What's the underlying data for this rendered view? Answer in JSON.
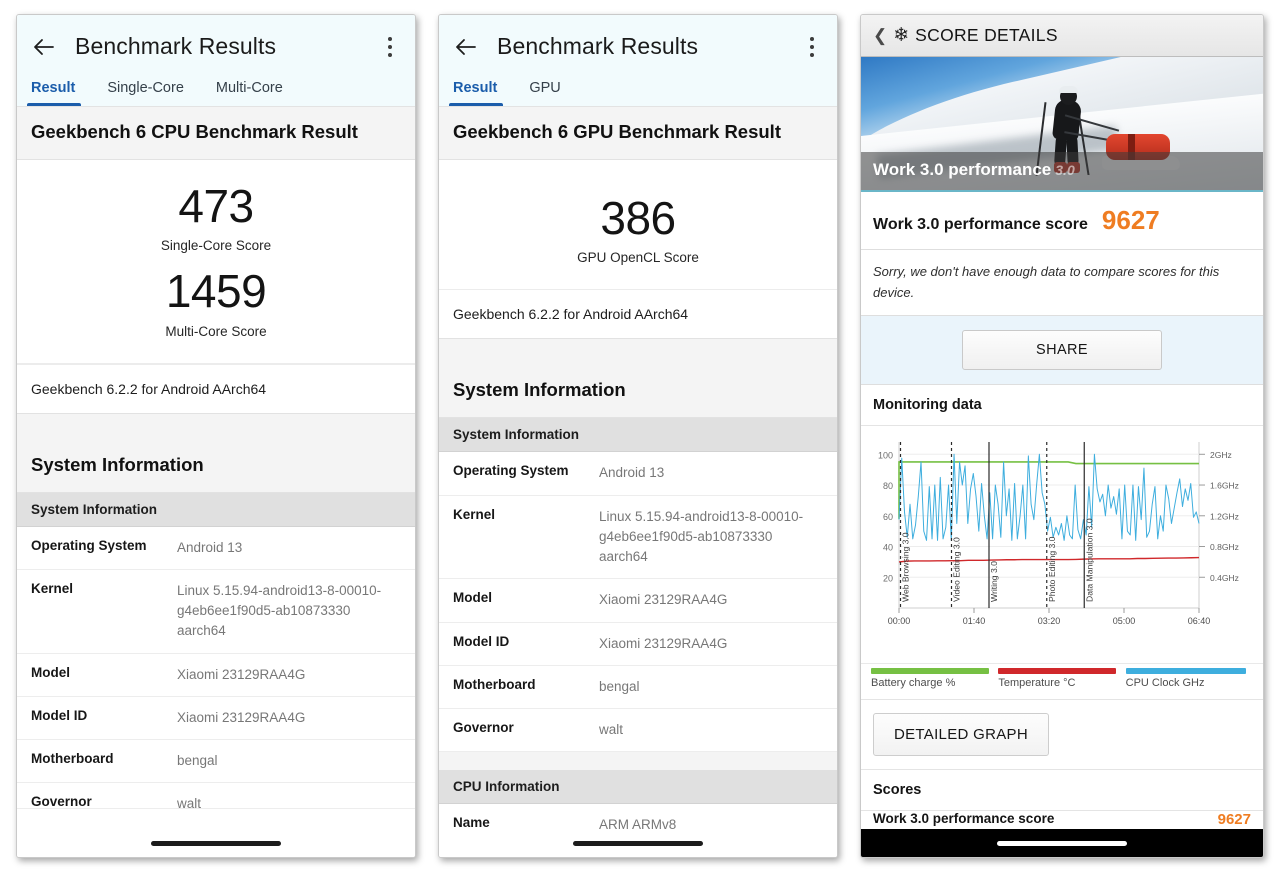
{
  "geekbench_cpu": {
    "appbar": {
      "back_icon": "back-arrow-icon",
      "title": "Benchmark Results",
      "menu_icon": "overflow-menu-icon"
    },
    "tabs": [
      {
        "label": "Result",
        "active": true
      },
      {
        "label": "Single-Core",
        "active": false
      },
      {
        "label": "Multi-Core",
        "active": false
      }
    ],
    "section_title": "Geekbench 6 CPU Benchmark Result",
    "scores": [
      {
        "value": "473",
        "label": "Single-Core Score"
      },
      {
        "value": "1459",
        "label": "Multi-Core Score"
      }
    ],
    "version": "Geekbench 6.2.2 for Android AArch64",
    "system_information_heading": "System Information",
    "system_information_subheader": "System Information",
    "rows": [
      {
        "key": "Operating System",
        "value": "Android 13"
      },
      {
        "key": "Kernel",
        "value": "Linux 5.15.94-android13-8-00010-g4eb6ee1f90d5-ab10873330 aarch64"
      },
      {
        "key": "Model",
        "value": "Xiaomi 23129RAA4G"
      },
      {
        "key": "Model ID",
        "value": "Xiaomi 23129RAA4G"
      },
      {
        "key": "Motherboard",
        "value": "bengal"
      },
      {
        "key": "Governor",
        "value": "walt"
      }
    ]
  },
  "geekbench_gpu": {
    "appbar": {
      "back_icon": "back-arrow-icon",
      "title": "Benchmark Results",
      "menu_icon": "overflow-menu-icon"
    },
    "tabs": [
      {
        "label": "Result",
        "active": true
      },
      {
        "label": "GPU",
        "active": false
      }
    ],
    "section_title": "Geekbench 6 GPU Benchmark Result",
    "scores": [
      {
        "value": "386",
        "label": "GPU OpenCL Score"
      }
    ],
    "version": "Geekbench 6.2.2 for Android AArch64",
    "system_information_heading": "System Information",
    "system_information_subheader": "System Information",
    "rows": [
      {
        "key": "Operating System",
        "value": "Android 13"
      },
      {
        "key": "Kernel",
        "value": "Linux 5.15.94-android13-8-00010-g4eb6ee1f90d5-ab10873330 aarch64"
      },
      {
        "key": "Model",
        "value": "Xiaomi 23129RAA4G"
      },
      {
        "key": "Model ID",
        "value": "Xiaomi 23129RAA4G"
      },
      {
        "key": "Motherboard",
        "value": "bengal"
      },
      {
        "key": "Governor",
        "value": "walt"
      }
    ],
    "cpu_information_subheader": "CPU Information",
    "cpu_rows": [
      {
        "key": "Name",
        "value": "ARM ARMv8"
      }
    ]
  },
  "pcmark": {
    "appbar": {
      "back_icon": "back-chevron-icon",
      "brand_icon": "snowflake-icon",
      "title": "SCORE DETAILS"
    },
    "hero_caption": "Work 3.0 performance",
    "hero_caption_faint": "3.0",
    "score_label": "Work 3.0 performance score",
    "score_value": "9627",
    "note": "Sorry, we don't have enough data to compare scores for this device.",
    "share_label": "SHARE",
    "monitoring_heading": "Monitoring data",
    "detailed_graph_label": "DETAILED GRAPH",
    "scores_heading": "Scores",
    "cut_row": {
      "label": "Work 3.0 performance score",
      "value": "9627"
    },
    "colors": {
      "battery": "#76c043",
      "temperature": "#d0282b",
      "cpu": "#3eaede",
      "score_accent": "#ef7d22"
    }
  },
  "chart_data": {
    "type": "line",
    "title": "Monitoring data",
    "xlabel": "",
    "ylabel": "",
    "grid": true,
    "legend_position": "bottom",
    "x_ticks": [
      "00:00",
      "01:40",
      "03:20",
      "05:00",
      "06:40"
    ],
    "xlim": [
      0,
      420
    ],
    "y_left_ticks": [
      20,
      40,
      60,
      80,
      100
    ],
    "ylim_left": [
      0,
      108
    ],
    "y_right_ticks": [
      "0.4GHz",
      "0.8GHz",
      "1.2GHz",
      "1.6GHz",
      "2GHz"
    ],
    "ylim_right": [
      0,
      2.16
    ],
    "annotations": [
      {
        "label": "Web Browsing 3.0",
        "x": "00:02"
      },
      {
        "label": "Video Editing 3.0",
        "x": "01:10"
      },
      {
        "label": "Writing 3.0",
        "x": "02:00"
      },
      {
        "label": "Photo Editing 3.0",
        "x": "03:17"
      },
      {
        "label": "Data Manipulation 3.0",
        "x": "04:07"
      }
    ],
    "series": [
      {
        "name": "Battery charge %",
        "color": "#76c043",
        "unit": "%",
        "axis": "left",
        "values": [
          95,
          95,
          95,
          95,
          95,
          95,
          95,
          95,
          95,
          95,
          95,
          95,
          95,
          95,
          95,
          95,
          95,
          95,
          95,
          95,
          95,
          95,
          95,
          94,
          94,
          94,
          94,
          94,
          94,
          94,
          94,
          94,
          94,
          94,
          94,
          94,
          94,
          94,
          94,
          94
        ]
      },
      {
        "name": "Temperature °C",
        "color": "#d0282b",
        "unit": "°C",
        "axis": "left",
        "values": [
          30,
          30.5,
          30.6,
          30.6,
          30.6,
          30.7,
          30.7,
          30.8,
          30.8,
          31,
          31,
          31,
          31.2,
          31.3,
          31.4,
          31.4,
          31.5,
          31.5,
          31.5,
          31.5,
          31.5,
          31.5,
          31.5,
          31.6,
          31.8,
          31.9,
          32,
          32,
          32,
          32,
          32,
          32.2,
          32.2,
          32.3,
          32.4,
          32.5,
          32.5,
          32.6,
          32.7,
          32.8
        ]
      },
      {
        "name": "CPU Clock GHz",
        "color": "#3eaede",
        "unit": "GHz",
        "axis": "right",
        "values": [
          1.15,
          1.95,
          1.25,
          0.92,
          1.35,
          0.9,
          1.08,
          1.45,
          1.9,
          1.0,
          0.88,
          1.58,
          0.9,
          1.6,
          0.88,
          1.7,
          0.9,
          1.05,
          1.6,
          0.88,
          2.0,
          1.1,
          1.9,
          1.6,
          1.85,
          1.1,
          1.55,
          1.75,
          1.45,
          1.0,
          1.62,
          1.2,
          0.9,
          1.5,
          0.9,
          1.6,
          1.35,
          0.92,
          1.9,
          1.2,
          1.55,
          0.88,
          1.62,
          0.9,
          1.2,
          1.6,
          0.9,
          1.98,
          1.35,
          1.15,
          1.6,
          2.0,
          1.5,
          1.35,
          1.0,
          1.18,
          0.92,
          1.05,
          0.95,
          1.1,
          0.88,
          1.2,
          0.95,
          0.9,
          1.6,
          1.02,
          0.9,
          1.15,
          0.95,
          1.58,
          1.05,
          2.0,
          1.55,
          1.38,
          1.48,
          1.2,
          1.6,
          1.3,
          1.45,
          1.22,
          1.55,
          0.9,
          1.6,
          1.0,
          0.95,
          1.6,
          0.88,
          1.58,
          1.15,
          1.82,
          0.92,
          1.0,
          1.35,
          1.58,
          0.9,
          1.2,
          1.0,
          1.6,
          1.42,
          1.1,
          1.3,
          1.5,
          1.68,
          1.32,
          1.55,
          1.4,
          1.62,
          1.18,
          1.25,
          1.1
        ]
      }
    ]
  }
}
